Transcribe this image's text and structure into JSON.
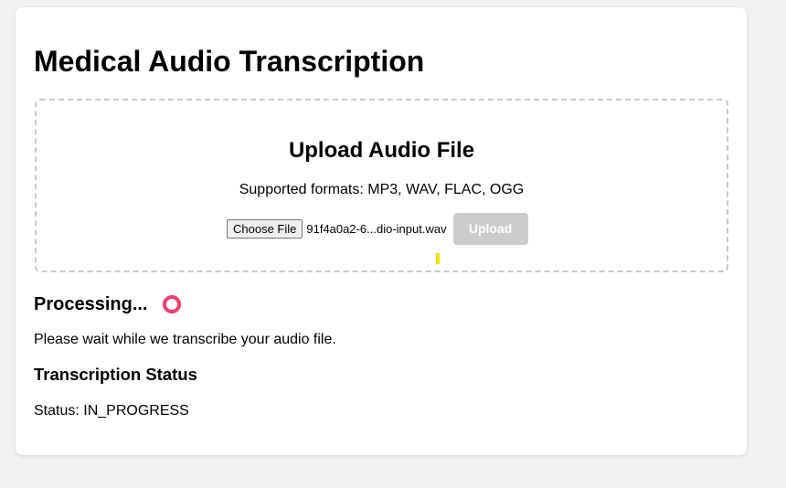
{
  "page": {
    "title": "Medical Audio Transcription"
  },
  "upload": {
    "heading": "Upload Audio File",
    "formats_text": "Supported formats: MP3, WAV, FLAC, OGG",
    "choose_file_label": "Choose File",
    "file_name": "91f4a0a2-6...dio-input.wav",
    "upload_label": "Upload",
    "upload_enabled": false
  },
  "processing": {
    "heading": "Processing...",
    "message": "Please wait while we transcribe your audio file."
  },
  "status": {
    "heading": "Transcription Status",
    "text": "Status: IN_PROGRESS"
  },
  "colors": {
    "spinner": "#f03e6e",
    "progress_marker": "#f3e100",
    "disabled_button": "#cccccc"
  },
  "icons": {
    "spinner": "loading-spinner-icon"
  }
}
